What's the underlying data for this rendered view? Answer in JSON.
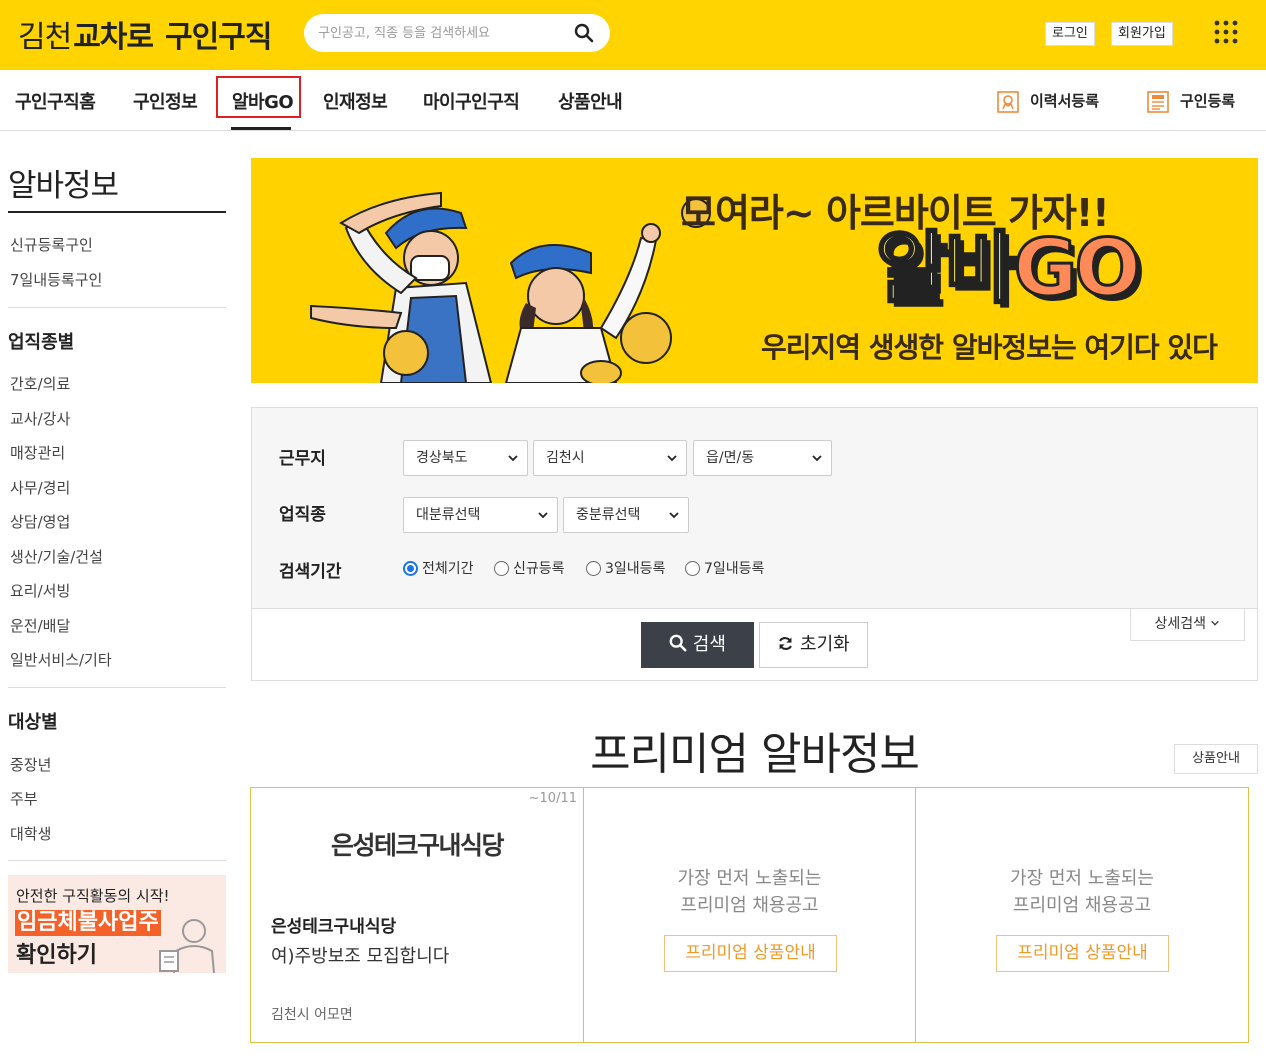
{
  "header": {
    "logo_part1": "김천",
    "logo_part2": "교차로",
    "logo_part3": "구인구직",
    "search_placeholder": "구인공고, 직종 등을 검색하세요",
    "login_label": "로그인",
    "signup_label": "회원가입"
  },
  "nav": {
    "items": [
      "구인구직홈",
      "구인정보",
      "알바GO",
      "인재정보",
      "마이구인구직",
      "상품안내"
    ],
    "active": "알바GO",
    "resume_label": "이력서등록",
    "job_post_label": "구인등록"
  },
  "sidebar": {
    "title": "알바정보",
    "quick_links": [
      "신규등록구인",
      "7일내등록구인"
    ],
    "category_heading": "업직종별",
    "categories": [
      "간호/의료",
      "교사/강사",
      "매장관리",
      "사무/경리",
      "상담/영업",
      "생산/기술/건설",
      "요리/서빙",
      "운전/배달",
      "일반서비스/기타"
    ],
    "target_heading": "대상별",
    "targets": [
      "중장년",
      "주부",
      "대학생"
    ],
    "banner": {
      "line1": "안전한 구직활동의 시작!",
      "line2": "임금체불사업주",
      "line3": "확인하기"
    }
  },
  "hero": {
    "line1": "모여라~ 아르바이트 가자!!",
    "line2a": "알바",
    "line2b": "GO",
    "line3": "우리지역 생생한 알바정보는 여기다 있다"
  },
  "search_panel": {
    "location_label": "근무지",
    "location_values": [
      "경상북도",
      "김천시",
      "읍/면/동"
    ],
    "job_label": "업직종",
    "job_values": [
      "대분류선택",
      "중분류선택"
    ],
    "period_label": "검색기간",
    "period_options": [
      "전체기간",
      "신규등록",
      "3일내등록",
      "7일내등록"
    ],
    "period_selected": "전체기간",
    "search_button": "검색",
    "reset_button": "초기화",
    "detail_button": "상세검색"
  },
  "premium": {
    "title": "프리미엄 알바정보",
    "guide_button": "상품안내",
    "listing": {
      "date": "~10/11",
      "logo_text": "은성테크구내식당",
      "company": "은성테크구내식당",
      "title": "여)주방보조 모집합니다",
      "location": "김천시 어모면"
    },
    "empty_line1": "가장 먼저 노출되는",
    "empty_line2": "프리미엄 채용공고",
    "empty_button": "프리미엄 상품안내"
  },
  "colors": {
    "brand_yellow": "#ffd400",
    "active_outline": "#e02020",
    "search_button": "#3c4048",
    "premium_border": "#e0c048",
    "premium_accent": "#f09a2a"
  }
}
